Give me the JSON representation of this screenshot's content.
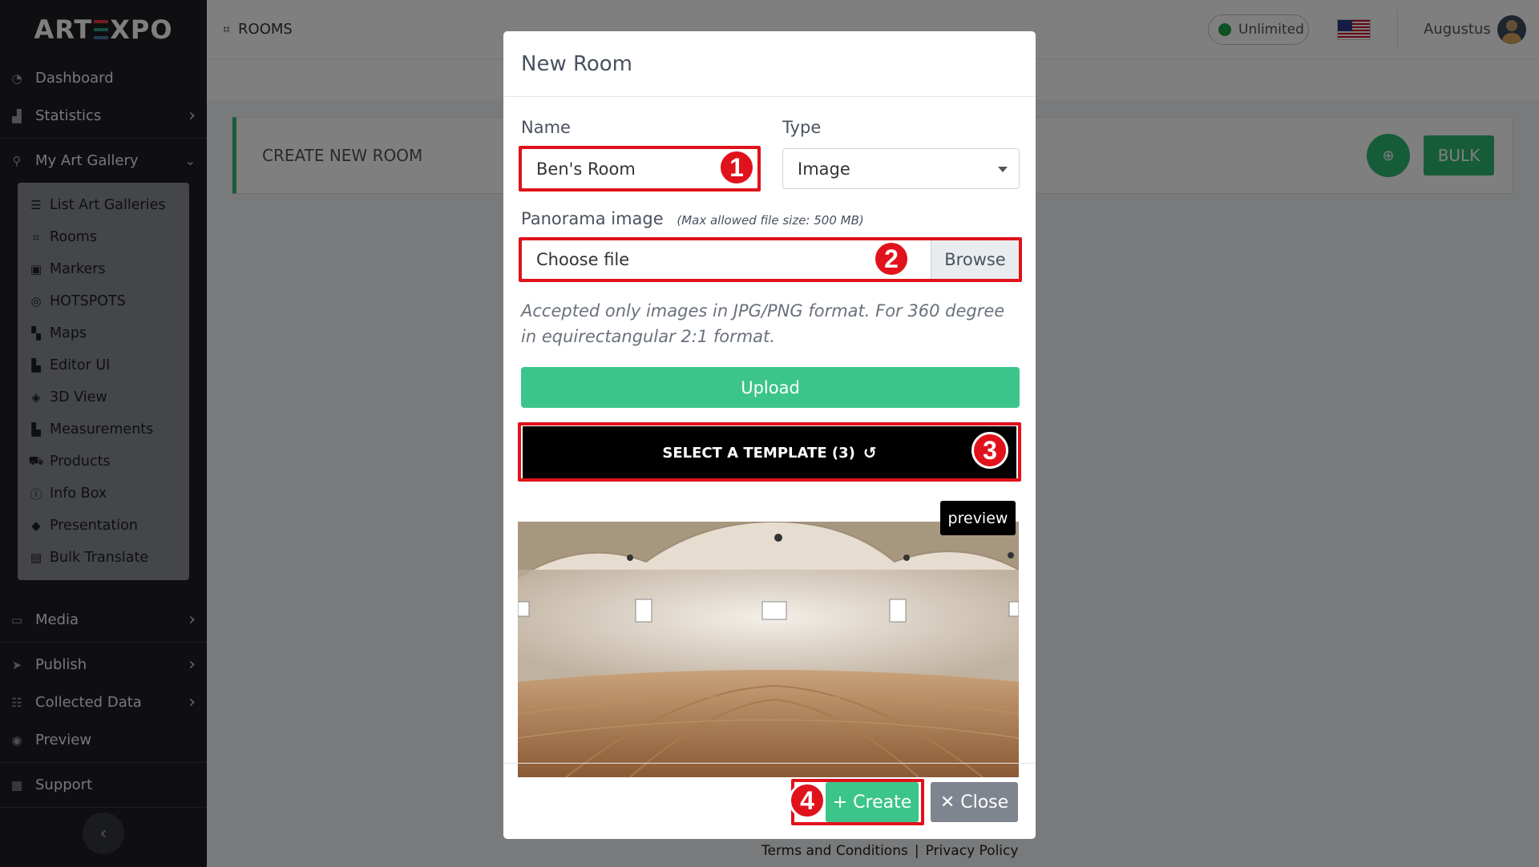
{
  "app": {
    "logo": "ARTEXPO"
  },
  "sidebar": {
    "items_top": [
      {
        "label": "Dashboard",
        "icon": "dashboard-icon"
      },
      {
        "label": "Statistics",
        "icon": "chart-icon"
      }
    ],
    "gallery_label": "My Art Gallery",
    "submenu": [
      {
        "label": "List Art Galleries",
        "icon": "list-icon"
      },
      {
        "label": "Rooms",
        "icon": "room-icon"
      },
      {
        "label": "Markers",
        "icon": "marker-icon"
      },
      {
        "label": "HOTSPOTS",
        "icon": "target-icon"
      },
      {
        "label": "Maps",
        "icon": "map-icon"
      },
      {
        "label": "Editor UI",
        "icon": "editor-icon"
      },
      {
        "label": "3D View",
        "icon": "cube-icon"
      },
      {
        "label": "Measurements",
        "icon": "ruler-icon"
      },
      {
        "label": "Products",
        "icon": "cart-icon"
      },
      {
        "label": "Info Box",
        "icon": "info-icon"
      },
      {
        "label": "Presentation",
        "icon": "diamond-icon"
      },
      {
        "label": "Bulk Translate",
        "icon": "translate-icon"
      }
    ],
    "items_bottom": [
      {
        "label": "Media",
        "icon": "monitor-icon"
      },
      {
        "label": "Publish",
        "icon": "send-icon"
      },
      {
        "label": "Collected Data",
        "icon": "database-icon"
      },
      {
        "label": "Preview",
        "icon": "eye-icon"
      },
      {
        "label": "Support",
        "icon": "support-icon"
      }
    ]
  },
  "topbar": {
    "breadcrumb": "ROOMS",
    "plan": "Unlimited",
    "user": "Augustus"
  },
  "main": {
    "card_title": "CREATE NEW ROOM",
    "bulk_label": "BULK"
  },
  "footer": {
    "terms": "Terms and Conditions",
    "separator": "|",
    "privacy": "Privacy Policy"
  },
  "modal": {
    "title": "New Room",
    "name_label": "Name",
    "name_value": "Ben's Room",
    "type_label": "Type",
    "type_value": "Image",
    "panorama_label": "Panorama image",
    "panorama_note": "(Max allowed file size: 500 MB)",
    "file_placeholder": "Choose file",
    "browse_label": "Browse",
    "hint": "Accepted only images in JPG/PNG format. For 360 degree in equirectangular 2:1 format.",
    "upload_label": "Upload",
    "template_label": "SELECT A TEMPLATE (3)",
    "preview_label": "preview",
    "create_label": "+ Create",
    "close_label": "✕ Close"
  },
  "annotations": [
    "1",
    "2",
    "3",
    "4"
  ],
  "colors": {
    "accent_green": "#2fb872",
    "highlight_red": "#e0121b",
    "sidebar_bg": "#1e1f23"
  }
}
